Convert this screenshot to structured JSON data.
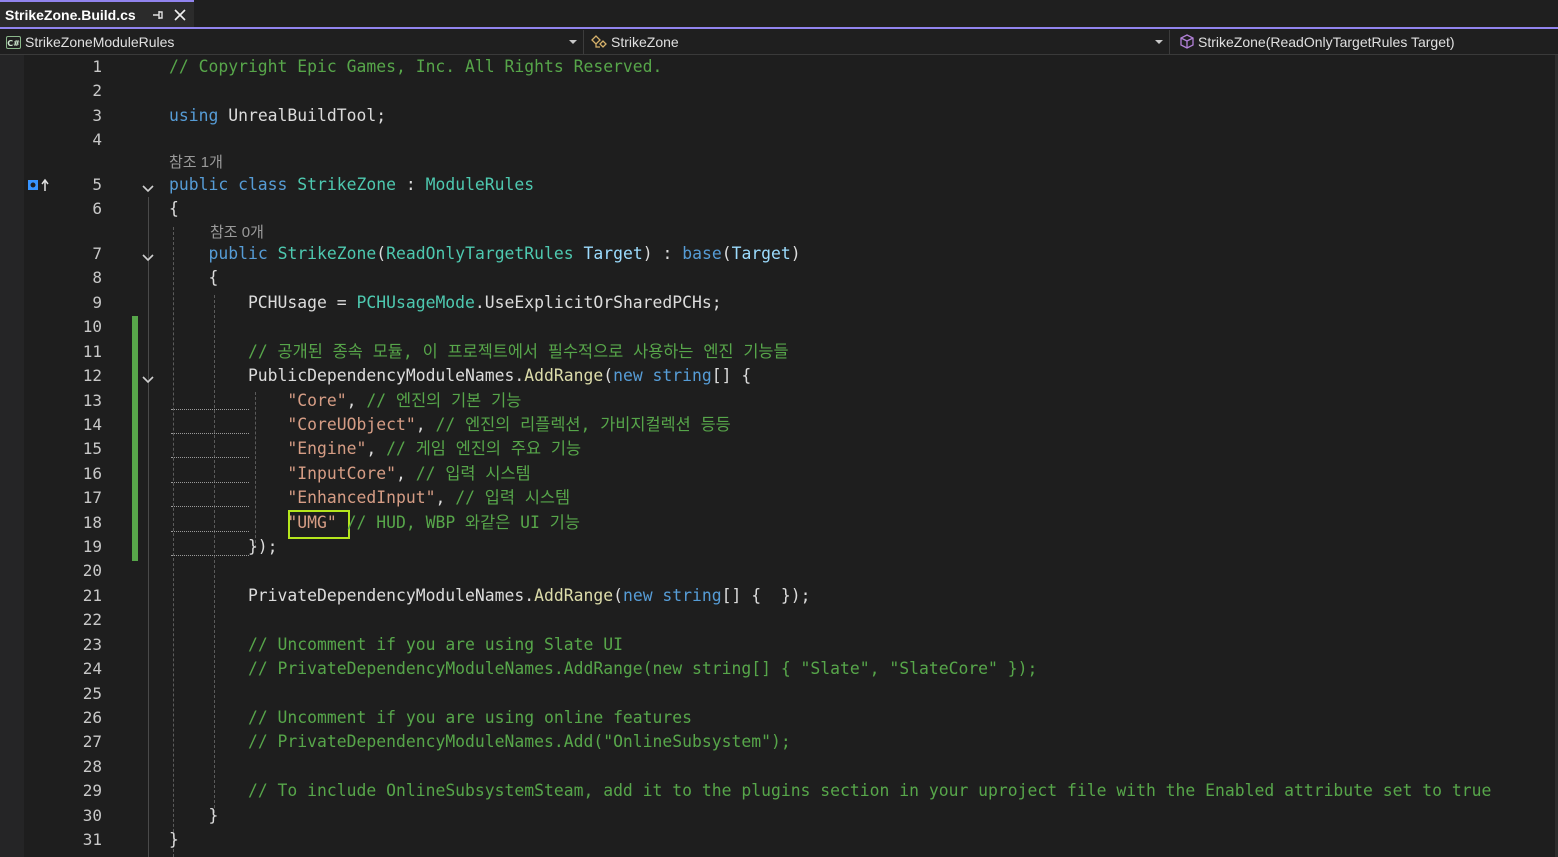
{
  "tab": {
    "title": "StrikeZone.Build.cs"
  },
  "navbar": {
    "project_scope": "StrikeZoneModuleRules",
    "type_scope": "StrikeZone",
    "member_scope": "StrikeZone(ReadOnlyTargetRules Target)"
  },
  "codelens": {
    "class_refs": "참조 1개",
    "ctor_refs": "참조 0개"
  },
  "colors": {
    "keyword": "#569cd6",
    "type": "#4ec9b0",
    "string": "#d69d85",
    "comment": "#57a64a",
    "parameter": "#9cdcfe",
    "method": "#dcdcaa",
    "accent": "#9184ee",
    "highlight_box": "#b5e61d"
  },
  "lines": [
    {
      "n": "1",
      "tokens": [
        {
          "c": "cm",
          "t": "// Copyright Epic Games, Inc. All Rights Reserved."
        }
      ]
    },
    {
      "n": "2",
      "tokens": []
    },
    {
      "n": "3",
      "tokens": [
        {
          "c": "kw",
          "t": "using"
        },
        {
          "c": "pl",
          "t": " UnrealBuildTool;"
        }
      ]
    },
    {
      "n": "4",
      "tokens": []
    },
    {
      "n": "5",
      "tokens": [
        {
          "c": "kw",
          "t": "public class"
        },
        {
          "c": "pl",
          "t": " "
        },
        {
          "c": "ty",
          "t": "StrikeZone"
        },
        {
          "c": "pl",
          "t": " : "
        },
        {
          "c": "ty",
          "t": "ModuleRules"
        }
      ]
    },
    {
      "n": "6",
      "tokens": [
        {
          "c": "pl",
          "t": "{"
        }
      ]
    },
    {
      "n": "7",
      "tokens": [
        {
          "c": "pl",
          "t": "    "
        },
        {
          "c": "kw",
          "t": "public"
        },
        {
          "c": "pl",
          "t": " "
        },
        {
          "c": "ty",
          "t": "StrikeZone"
        },
        {
          "c": "pl",
          "t": "("
        },
        {
          "c": "ty",
          "t": "ReadOnlyTargetRules"
        },
        {
          "c": "pl",
          "t": " "
        },
        {
          "c": "pm",
          "t": "Target"
        },
        {
          "c": "pl",
          "t": ") : "
        },
        {
          "c": "kw",
          "t": "base"
        },
        {
          "c": "pl",
          "t": "("
        },
        {
          "c": "pm",
          "t": "Target"
        },
        {
          "c": "pl",
          "t": ")"
        }
      ]
    },
    {
      "n": "8",
      "tokens": [
        {
          "c": "pl",
          "t": "    {"
        }
      ]
    },
    {
      "n": "9",
      "tokens": [
        {
          "c": "pl",
          "t": "        PCHUsage = "
        },
        {
          "c": "ty",
          "t": "PCHUsageMode"
        },
        {
          "c": "pl",
          "t": ".UseExplicitOrSharedPCHs;"
        }
      ]
    },
    {
      "n": "10",
      "tokens": []
    },
    {
      "n": "11",
      "tokens": [
        {
          "c": "pl",
          "t": "        "
        },
        {
          "c": "cm",
          "t": "// 공개된 종속 모듈, 이 프로젝트에서 필수적으로 사용하는 엔진 기능들"
        }
      ]
    },
    {
      "n": "12",
      "tokens": [
        {
          "c": "pl",
          "t": "        PublicDependencyModuleNames."
        },
        {
          "c": "fn",
          "t": "AddRange"
        },
        {
          "c": "pl",
          "t": "("
        },
        {
          "c": "kw",
          "t": "new string"
        },
        {
          "c": "pl",
          "t": "[] {"
        }
      ]
    },
    {
      "n": "13",
      "tokens": [
        {
          "c": "pl",
          "t": "            "
        },
        {
          "c": "st",
          "t": "\"Core\""
        },
        {
          "c": "pl",
          "t": ", "
        },
        {
          "c": "cm",
          "t": "// 엔진의 기본 기능"
        }
      ]
    },
    {
      "n": "14",
      "tokens": [
        {
          "c": "pl",
          "t": "            "
        },
        {
          "c": "st",
          "t": "\"CoreUObject\""
        },
        {
          "c": "pl",
          "t": ", "
        },
        {
          "c": "cm",
          "t": "// 엔진의 리플렉션, 가비지컬렉션 등등"
        }
      ]
    },
    {
      "n": "15",
      "tokens": [
        {
          "c": "pl",
          "t": "            "
        },
        {
          "c": "st",
          "t": "\"Engine\""
        },
        {
          "c": "pl",
          "t": ", "
        },
        {
          "c": "cm",
          "t": "// 게임 엔진의 주요 기능"
        }
      ]
    },
    {
      "n": "16",
      "tokens": [
        {
          "c": "pl",
          "t": "            "
        },
        {
          "c": "st",
          "t": "\"InputCore\""
        },
        {
          "c": "pl",
          "t": ", "
        },
        {
          "c": "cm",
          "t": "// 입력 시스템"
        }
      ]
    },
    {
      "n": "17",
      "tokens": [
        {
          "c": "pl",
          "t": "            "
        },
        {
          "c": "st",
          "t": "\"EnhancedInput\""
        },
        {
          "c": "pl",
          "t": ", "
        },
        {
          "c": "cm",
          "t": "// 입력 시스템"
        }
      ]
    },
    {
      "n": "18",
      "tokens": [
        {
          "c": "pl",
          "t": "            "
        },
        {
          "c": "st",
          "t": "\"UMG\""
        },
        {
          "c": "pl",
          "t": " "
        },
        {
          "c": "cm",
          "t": "// HUD, WBP 와같은 UI 기능"
        }
      ]
    },
    {
      "n": "19",
      "tokens": [
        {
          "c": "pl",
          "t": "        });"
        }
      ]
    },
    {
      "n": "20",
      "tokens": []
    },
    {
      "n": "21",
      "tokens": [
        {
          "c": "pl",
          "t": "        PrivateDependencyModuleNames."
        },
        {
          "c": "fn",
          "t": "AddRange"
        },
        {
          "c": "pl",
          "t": "("
        },
        {
          "c": "kw",
          "t": "new string"
        },
        {
          "c": "pl",
          "t": "[] {  });"
        }
      ]
    },
    {
      "n": "22",
      "tokens": []
    },
    {
      "n": "23",
      "tokens": [
        {
          "c": "pl",
          "t": "        "
        },
        {
          "c": "cm",
          "t": "// Uncomment if you are using Slate UI"
        }
      ]
    },
    {
      "n": "24",
      "tokens": [
        {
          "c": "pl",
          "t": "        "
        },
        {
          "c": "cm",
          "t": "// PrivateDependencyModuleNames.AddRange(new string[] { \"Slate\", \"SlateCore\" });"
        }
      ]
    },
    {
      "n": "25",
      "tokens": []
    },
    {
      "n": "26",
      "tokens": [
        {
          "c": "pl",
          "t": "        "
        },
        {
          "c": "cm",
          "t": "// Uncomment if you are using online features"
        }
      ]
    },
    {
      "n": "27",
      "tokens": [
        {
          "c": "pl",
          "t": "        "
        },
        {
          "c": "cm",
          "t": "// PrivateDependencyModuleNames.Add(\"OnlineSubsystem\");"
        }
      ]
    },
    {
      "n": "28",
      "tokens": []
    },
    {
      "n": "29",
      "tokens": [
        {
          "c": "pl",
          "t": "        "
        },
        {
          "c": "cm",
          "t": "// To include OnlineSubsystemSteam, add it to the plugins section in your uproject file with the Enabled attribute set to true"
        }
      ]
    },
    {
      "n": "30",
      "tokens": [
        {
          "c": "pl",
          "t": "    }"
        }
      ]
    },
    {
      "n": "31",
      "tokens": [
        {
          "c": "pl",
          "t": "}"
        }
      ]
    }
  ]
}
